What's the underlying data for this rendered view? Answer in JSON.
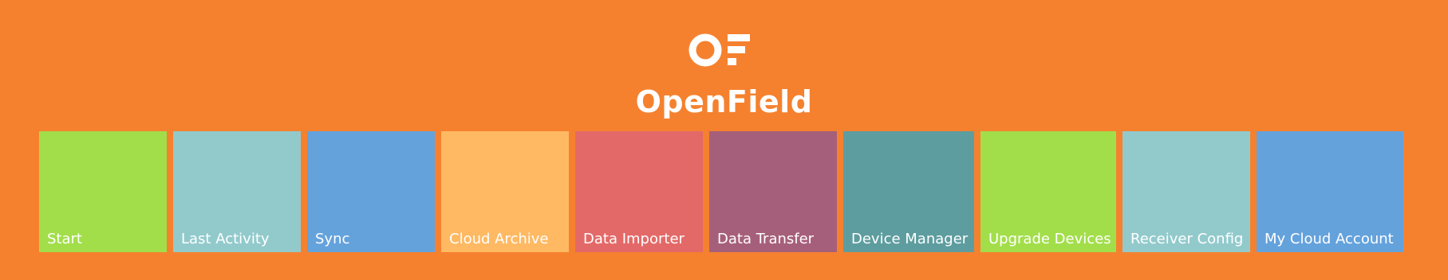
{
  "app": {
    "title": "OpenField",
    "logo_icon": "openfield-logo-icon",
    "background_color": "#F5812F"
  },
  "tiles": [
    {
      "label": "Start",
      "color": "#A2DE4A"
    },
    {
      "label": "Last Activity",
      "color": "#92CACC"
    },
    {
      "label": "Sync",
      "color": "#64A2DC"
    },
    {
      "label": "Cloud Archive",
      "color": "#FFB963"
    },
    {
      "label": "Data Importer",
      "color": "#E36968"
    },
    {
      "label": "Data Transfer",
      "color": "#A65F7A"
    },
    {
      "label": "Device Manager",
      "color": "#5E9D9F"
    },
    {
      "label": "Upgrade Devices",
      "color": "#A2DE4A"
    },
    {
      "label": "Receiver Config",
      "color": "#92CACC"
    },
    {
      "label": "My Cloud Account",
      "color": "#64A2DC"
    }
  ]
}
